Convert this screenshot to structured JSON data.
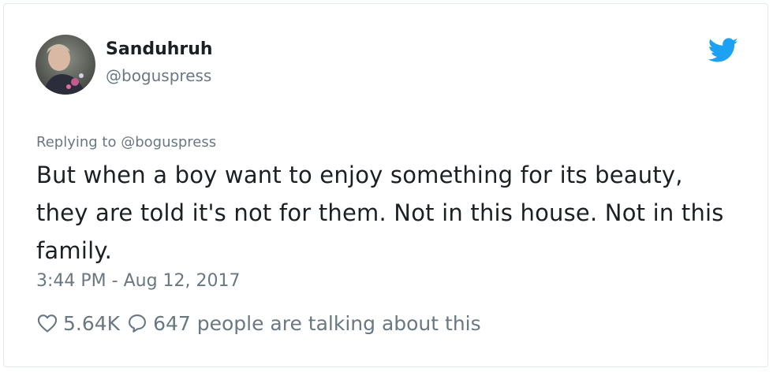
{
  "author": {
    "display_name": "Sanduhruh",
    "handle": "@boguspress",
    "avatar_icon": "user-avatar"
  },
  "platform_icon": "twitter-bird-icon",
  "brand_color": "#1da1f2",
  "reply": {
    "prefix": "Replying to",
    "mention": "@boguspress"
  },
  "tweet": {
    "text": "But when a boy want to enjoy something for its beauty, they are told it's not for them. Not in this house. Not in this family."
  },
  "timestamp": "3:44 PM - Aug 12, 2017",
  "engagement": {
    "likes": "5.64K",
    "likes_icon": "heart-icon",
    "conversation_icon": "speech-bubble-icon",
    "talking": "647 people are talking about this"
  }
}
